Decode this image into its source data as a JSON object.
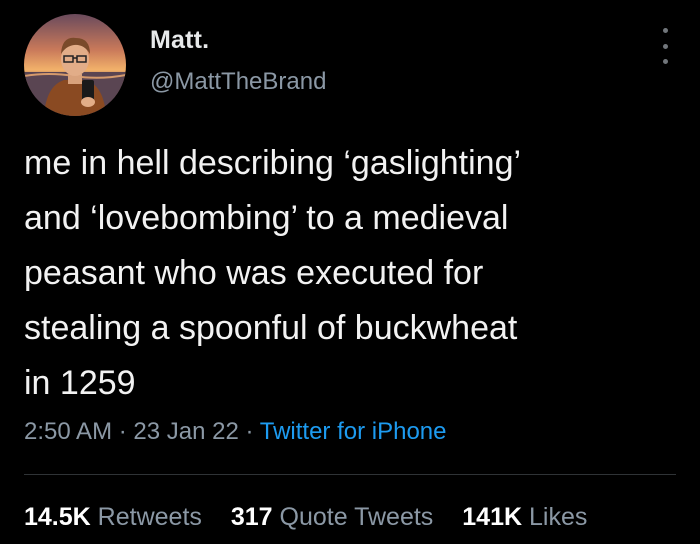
{
  "author": {
    "display_name": "Matt.",
    "handle": "@MattTheBrand"
  },
  "tweet": {
    "text": "me in hell describing ‘gaslighting’\nand ‘lovebombing’ to a medieval\npeasant who was executed for\nstealing a spoonful of buckwheat\nin 1259",
    "time": "2:50 AM",
    "date": "23 Jan 22",
    "separator": "·",
    "source": "Twitter for iPhone"
  },
  "stats": {
    "retweets_count": "14.5K",
    "retweets_label": "Retweets",
    "quotes_count": "317",
    "quotes_label": "Quote Tweets",
    "likes_count": "141K",
    "likes_label": "Likes"
  },
  "colors": {
    "background": "#000000",
    "text": "#e7e9ea",
    "secondary": "#8b98a5",
    "link": "#1d9bf0",
    "divider": "#2f3336"
  },
  "icons": {
    "more": "more-vertical-icon"
  }
}
